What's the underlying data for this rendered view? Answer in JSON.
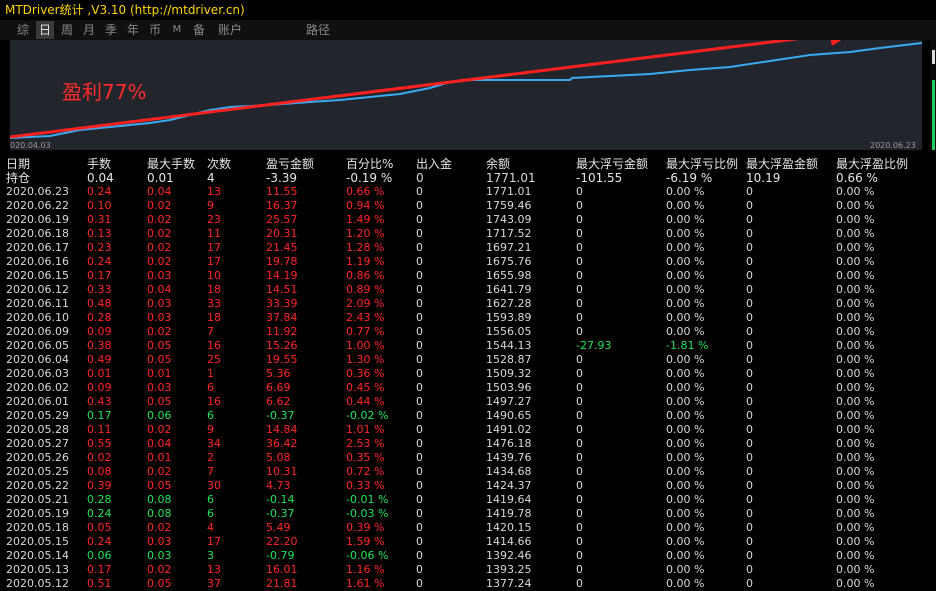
{
  "title": "MTDriver统计 ,V3.10 (http://mtdriver.cn)",
  "tabs": [
    "综",
    "日",
    "周",
    "月",
    "季",
    "年",
    "币",
    "M",
    "备",
    "账户",
    "路径"
  ],
  "active_tab": "日",
  "chart": {
    "start_label": "020.04.03",
    "end_label": "2020.06.23",
    "annotation": "盈利77%",
    "colors": {
      "line": "#3aa9f0",
      "arrow": "#ff2020",
      "bg": "#22262c"
    }
  },
  "table": {
    "headers": [
      "日期",
      "手数",
      "最大手数",
      "次数",
      "盈亏金额",
      "百分比%",
      "出入金",
      "余额",
      "最大浮亏金额",
      "最大浮亏比例",
      "最大浮盈金额",
      "最大浮盈比例"
    ],
    "holding": {
      "label": "持仓",
      "cells": [
        "0.04",
        "0.01",
        "4",
        "-3.39",
        "-0.19 %",
        "0",
        "1771.01",
        "-101.55",
        "-6.19 %",
        "10.19",
        "0.66 %"
      ],
      "colors": [
        "green",
        "green",
        "green",
        "green",
        "green",
        "neutral",
        "neutral",
        "green",
        "green",
        "red",
        "red"
      ]
    },
    "rows": [
      {
        "date": "2020.06.23",
        "lots": "0.24",
        "max_lots": "0.04",
        "count": "13",
        "pl": "11.55",
        "pct": "0.66 %",
        "io": "0",
        "balance": "1771.01",
        "max_float_loss": "0",
        "max_float_loss_pct": "0.00 %",
        "max_float_profit": "0",
        "max_float_profit_pct": "0.00 %",
        "tone": "red"
      },
      {
        "date": "2020.06.22",
        "lots": "0.10",
        "max_lots": "0.02",
        "count": "9",
        "pl": "16.37",
        "pct": "0.94 %",
        "io": "0",
        "balance": "1759.46",
        "max_float_loss": "0",
        "max_float_loss_pct": "0.00 %",
        "max_float_profit": "0",
        "max_float_profit_pct": "0.00 %",
        "tone": "red"
      },
      {
        "date": "2020.06.19",
        "lots": "0.31",
        "max_lots": "0.02",
        "count": "23",
        "pl": "25.57",
        "pct": "1.49 %",
        "io": "0",
        "balance": "1743.09",
        "max_float_loss": "0",
        "max_float_loss_pct": "0.00 %",
        "max_float_profit": "0",
        "max_float_profit_pct": "0.00 %",
        "tone": "red"
      },
      {
        "date": "2020.06.18",
        "lots": "0.13",
        "max_lots": "0.02",
        "count": "11",
        "pl": "20.31",
        "pct": "1.20 %",
        "io": "0",
        "balance": "1717.52",
        "max_float_loss": "0",
        "max_float_loss_pct": "0.00 %",
        "max_float_profit": "0",
        "max_float_profit_pct": "0.00 %",
        "tone": "red"
      },
      {
        "date": "2020.06.17",
        "lots": "0.23",
        "max_lots": "0.02",
        "count": "17",
        "pl": "21.45",
        "pct": "1.28 %",
        "io": "0",
        "balance": "1697.21",
        "max_float_loss": "0",
        "max_float_loss_pct": "0.00 %",
        "max_float_profit": "0",
        "max_float_profit_pct": "0.00 %",
        "tone": "red"
      },
      {
        "date": "2020.06.16",
        "lots": "0.24",
        "max_lots": "0.02",
        "count": "17",
        "pl": "19.78",
        "pct": "1.19 %",
        "io": "0",
        "balance": "1675.76",
        "max_float_loss": "0",
        "max_float_loss_pct": "0.00 %",
        "max_float_profit": "0",
        "max_float_profit_pct": "0.00 %",
        "tone": "red"
      },
      {
        "date": "2020.06.15",
        "lots": "0.17",
        "max_lots": "0.03",
        "count": "10",
        "pl": "14.19",
        "pct": "0.86 %",
        "io": "0",
        "balance": "1655.98",
        "max_float_loss": "0",
        "max_float_loss_pct": "0.00 %",
        "max_float_profit": "0",
        "max_float_profit_pct": "0.00 %",
        "tone": "red"
      },
      {
        "date": "2020.06.12",
        "lots": "0.33",
        "max_lots": "0.04",
        "count": "18",
        "pl": "14.51",
        "pct": "0.89 %",
        "io": "0",
        "balance": "1641.79",
        "max_float_loss": "0",
        "max_float_loss_pct": "0.00 %",
        "max_float_profit": "0",
        "max_float_profit_pct": "0.00 %",
        "tone": "red"
      },
      {
        "date": "2020.06.11",
        "lots": "0.48",
        "max_lots": "0.03",
        "count": "33",
        "pl": "33.39",
        "pct": "2.09 %",
        "io": "0",
        "balance": "1627.28",
        "max_float_loss": "0",
        "max_float_loss_pct": "0.00 %",
        "max_float_profit": "0",
        "max_float_profit_pct": "0.00 %",
        "tone": "red"
      },
      {
        "date": "2020.06.10",
        "lots": "0.28",
        "max_lots": "0.03",
        "count": "18",
        "pl": "37.84",
        "pct": "2.43 %",
        "io": "0",
        "balance": "1593.89",
        "max_float_loss": "0",
        "max_float_loss_pct": "0.00 %",
        "max_float_profit": "0",
        "max_float_profit_pct": "0.00 %",
        "tone": "red"
      },
      {
        "date": "2020.06.09",
        "lots": "0.09",
        "max_lots": "0.02",
        "count": "7",
        "pl": "11.92",
        "pct": "0.77 %",
        "io": "0",
        "balance": "1556.05",
        "max_float_loss": "0",
        "max_float_loss_pct": "0.00 %",
        "max_float_profit": "0",
        "max_float_profit_pct": "0.00 %",
        "tone": "red"
      },
      {
        "date": "2020.06.05",
        "lots": "0.38",
        "max_lots": "0.05",
        "count": "16",
        "pl": "15.26",
        "pct": "1.00 %",
        "io": "0",
        "balance": "1544.13",
        "max_float_loss": "-27.93",
        "max_float_loss_pct": "-1.81 %",
        "max_float_profit": "0",
        "max_float_profit_pct": "0.00 %",
        "tone": "red",
        "loss_tone": "green"
      },
      {
        "date": "2020.06.04",
        "lots": "0.49",
        "max_lots": "0.05",
        "count": "25",
        "pl": "19.55",
        "pct": "1.30 %",
        "io": "0",
        "balance": "1528.87",
        "max_float_loss": "0",
        "max_float_loss_pct": "0.00 %",
        "max_float_profit": "0",
        "max_float_profit_pct": "0.00 %",
        "tone": "red"
      },
      {
        "date": "2020.06.03",
        "lots": "0.01",
        "max_lots": "0.01",
        "count": "1",
        "pl": "5.36",
        "pct": "0.36 %",
        "io": "0",
        "balance": "1509.32",
        "max_float_loss": "0",
        "max_float_loss_pct": "0.00 %",
        "max_float_profit": "0",
        "max_float_profit_pct": "0.00 %",
        "tone": "red"
      },
      {
        "date": "2020.06.02",
        "lots": "0.09",
        "max_lots": "0.03",
        "count": "6",
        "pl": "6.69",
        "pct": "0.45 %",
        "io": "0",
        "balance": "1503.96",
        "max_float_loss": "0",
        "max_float_loss_pct": "0.00 %",
        "max_float_profit": "0",
        "max_float_profit_pct": "0.00 %",
        "tone": "red"
      },
      {
        "date": "2020.06.01",
        "lots": "0.43",
        "max_lots": "0.05",
        "count": "16",
        "pl": "6.62",
        "pct": "0.44 %",
        "io": "0",
        "balance": "1497.27",
        "max_float_loss": "0",
        "max_float_loss_pct": "0.00 %",
        "max_float_profit": "0",
        "max_float_profit_pct": "0.00 %",
        "tone": "red"
      },
      {
        "date": "2020.05.29",
        "lots": "0.17",
        "max_lots": "0.06",
        "count": "6",
        "pl": "-0.37",
        "pct": "-0.02 %",
        "io": "0",
        "balance": "1490.65",
        "max_float_loss": "0",
        "max_float_loss_pct": "0.00 %",
        "max_float_profit": "0",
        "max_float_profit_pct": "0.00 %",
        "tone": "green"
      },
      {
        "date": "2020.05.28",
        "lots": "0.11",
        "max_lots": "0.02",
        "count": "9",
        "pl": "14.84",
        "pct": "1.01 %",
        "io": "0",
        "balance": "1491.02",
        "max_float_loss": "0",
        "max_float_loss_pct": "0.00 %",
        "max_float_profit": "0",
        "max_float_profit_pct": "0.00 %",
        "tone": "red"
      },
      {
        "date": "2020.05.27",
        "lots": "0.55",
        "max_lots": "0.04",
        "count": "34",
        "pl": "36.42",
        "pct": "2.53 %",
        "io": "0",
        "balance": "1476.18",
        "max_float_loss": "0",
        "max_float_loss_pct": "0.00 %",
        "max_float_profit": "0",
        "max_float_profit_pct": "0.00 %",
        "tone": "red"
      },
      {
        "date": "2020.05.26",
        "lots": "0.02",
        "max_lots": "0.01",
        "count": "2",
        "pl": "5.08",
        "pct": "0.35 %",
        "io": "0",
        "balance": "1439.76",
        "max_float_loss": "0",
        "max_float_loss_pct": "0.00 %",
        "max_float_profit": "0",
        "max_float_profit_pct": "0.00 %",
        "tone": "red"
      },
      {
        "date": "2020.05.25",
        "lots": "0.08",
        "max_lots": "0.02",
        "count": "7",
        "pl": "10.31",
        "pct": "0.72 %",
        "io": "0",
        "balance": "1434.68",
        "max_float_loss": "0",
        "max_float_loss_pct": "0.00 %",
        "max_float_profit": "0",
        "max_float_profit_pct": "0.00 %",
        "tone": "red"
      },
      {
        "date": "2020.05.22",
        "lots": "0.39",
        "max_lots": "0.05",
        "count": "30",
        "pl": "4.73",
        "pct": "0.33 %",
        "io": "0",
        "balance": "1424.37",
        "max_float_loss": "0",
        "max_float_loss_pct": "0.00 %",
        "max_float_profit": "0",
        "max_float_profit_pct": "0.00 %",
        "tone": "red"
      },
      {
        "date": "2020.05.21",
        "lots": "0.28",
        "max_lots": "0.08",
        "count": "6",
        "pl": "-0.14",
        "pct": "-0.01 %",
        "io": "0",
        "balance": "1419.64",
        "max_float_loss": "0",
        "max_float_loss_pct": "0.00 %",
        "max_float_profit": "0",
        "max_float_profit_pct": "0.00 %",
        "tone": "green"
      },
      {
        "date": "2020.05.19",
        "lots": "0.24",
        "max_lots": "0.08",
        "count": "6",
        "pl": "-0.37",
        "pct": "-0.03 %",
        "io": "0",
        "balance": "1419.78",
        "max_float_loss": "0",
        "max_float_loss_pct": "0.00 %",
        "max_float_profit": "0",
        "max_float_profit_pct": "0.00 %",
        "tone": "green"
      },
      {
        "date": "2020.05.18",
        "lots": "0.05",
        "max_lots": "0.02",
        "count": "4",
        "pl": "5.49",
        "pct": "0.39 %",
        "io": "0",
        "balance": "1420.15",
        "max_float_loss": "0",
        "max_float_loss_pct": "0.00 %",
        "max_float_profit": "0",
        "max_float_profit_pct": "0.00 %",
        "tone": "red"
      },
      {
        "date": "2020.05.15",
        "lots": "0.24",
        "max_lots": "0.03",
        "count": "17",
        "pl": "22.20",
        "pct": "1.59 %",
        "io": "0",
        "balance": "1414.66",
        "max_float_loss": "0",
        "max_float_loss_pct": "0.00 %",
        "max_float_profit": "0",
        "max_float_profit_pct": "0.00 %",
        "tone": "red"
      },
      {
        "date": "2020.05.14",
        "lots": "0.06",
        "max_lots": "0.03",
        "count": "3",
        "pl": "-0.79",
        "pct": "-0.06 %",
        "io": "0",
        "balance": "1392.46",
        "max_float_loss": "0",
        "max_float_loss_pct": "0.00 %",
        "max_float_profit": "0",
        "max_float_profit_pct": "0.00 %",
        "tone": "green"
      },
      {
        "date": "2020.05.13",
        "lots": "0.17",
        "max_lots": "0.02",
        "count": "13",
        "pl": "16.01",
        "pct": "1.16 %",
        "io": "0",
        "balance": "1393.25",
        "max_float_loss": "0",
        "max_float_loss_pct": "0.00 %",
        "max_float_profit": "0",
        "max_float_profit_pct": "0.00 %",
        "tone": "red"
      },
      {
        "date": "2020.05.12",
        "lots": "0.51",
        "max_lots": "0.05",
        "count": "37",
        "pl": "21.81",
        "pct": "1.61 %",
        "io": "0",
        "balance": "1377.24",
        "max_float_loss": "0",
        "max_float_loss_pct": "0.00 %",
        "max_float_profit": "0",
        "max_float_profit_pct": "0.00 %",
        "tone": "red"
      }
    ]
  }
}
